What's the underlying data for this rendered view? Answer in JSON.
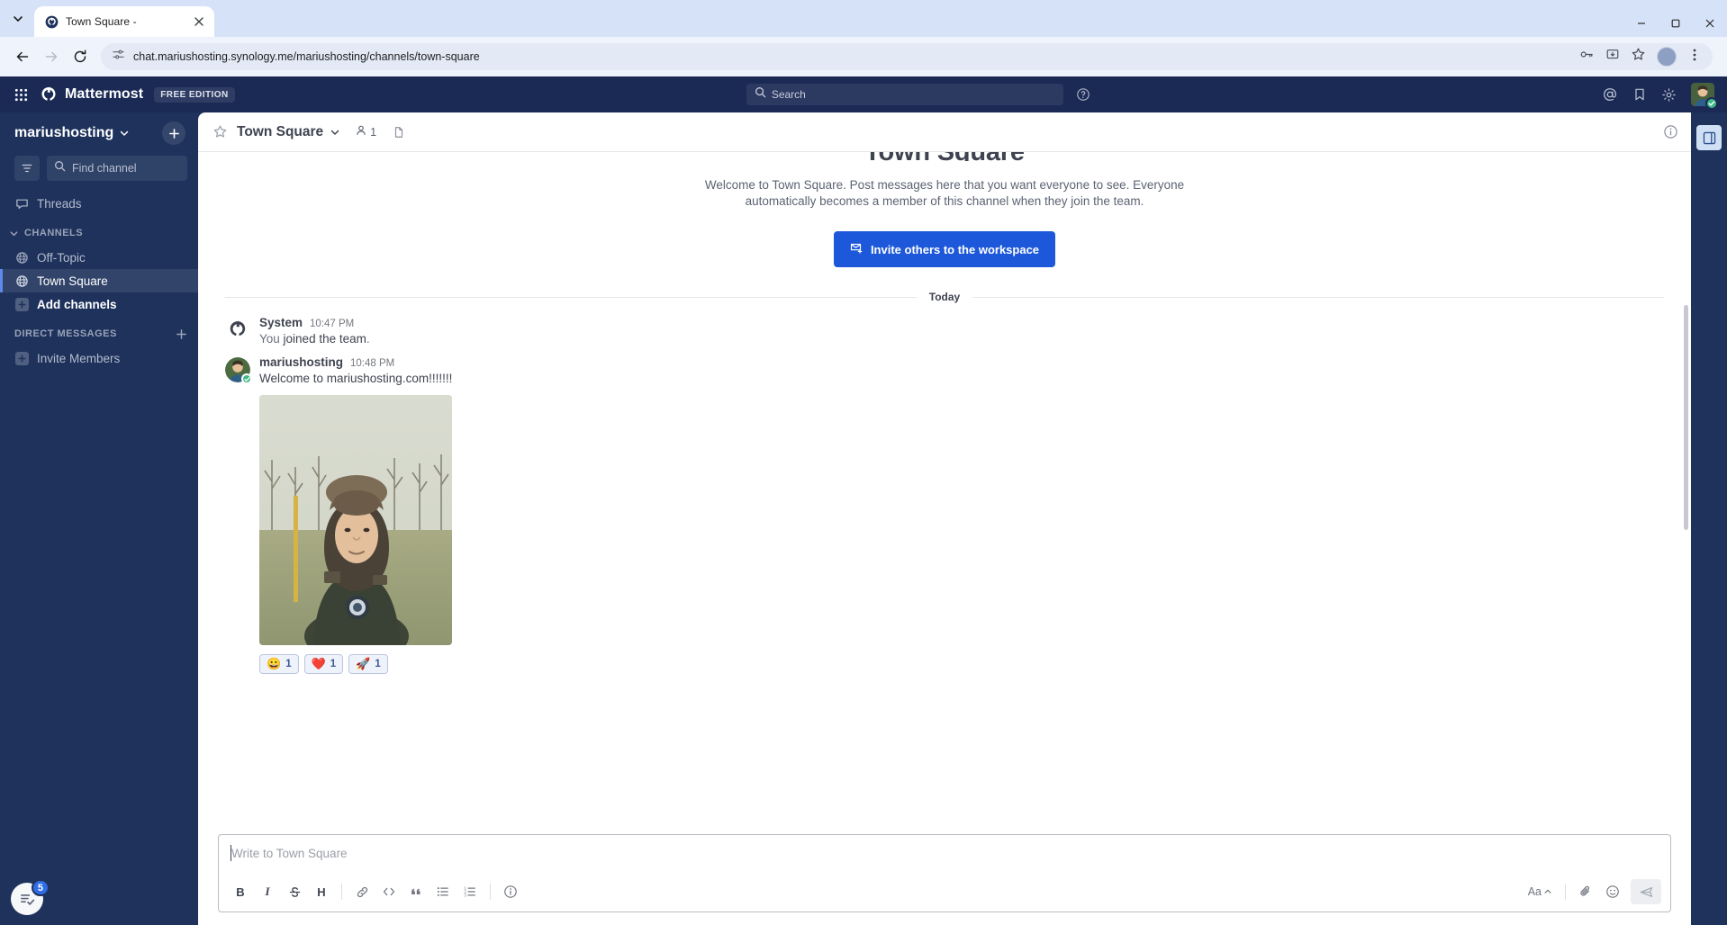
{
  "browser": {
    "tab": {
      "title": "Town Square -",
      "favicon_icon": "mattermost-favicon"
    },
    "url": "chat.mariushosting.synology.me/mariushosting/channels/town-square",
    "nav": {
      "back": "back-icon",
      "forward": "forward-icon",
      "reload": "reload-icon"
    },
    "omnibox_icons": [
      "site-settings-icon",
      "password-key-icon",
      "install-app-icon",
      "bookmark-star-icon"
    ],
    "window_controls": {
      "minimize": "–",
      "maximize": "☐",
      "close": "✕"
    }
  },
  "global_header": {
    "product_switcher_icon": "grid-apps-icon",
    "brand": "Mattermost",
    "edition_badge": "FREE EDITION",
    "search": {
      "placeholder": "Search",
      "icon": "search-icon"
    },
    "help_icon": "help-circle-icon",
    "icons": [
      "at-mention-icon",
      "saved-posts-icon",
      "settings-gear-icon"
    ],
    "avatar": {
      "name": "avatar",
      "status": "online"
    }
  },
  "sidebar": {
    "team_name": "mariushosting",
    "team_chevron_icon": "chevron-down-icon",
    "add_button_icon": "plus-icon",
    "filter_icon": "filter-icon",
    "find_channel_placeholder": "Find channel",
    "threads": {
      "label": "Threads",
      "icon": "threads-icon"
    },
    "categories": [
      {
        "label": "CHANNELS",
        "chevron_icon": "chevron-down-icon",
        "items": [
          {
            "label": "Off-Topic",
            "icon": "globe-icon",
            "active": false
          },
          {
            "label": "Town Square",
            "icon": "globe-icon",
            "active": true
          },
          {
            "label": "Add channels",
            "icon": "plus-square-icon",
            "active": false,
            "bold": true
          }
        ]
      },
      {
        "label": "DIRECT MESSAGES",
        "add_icon": "plus-icon",
        "items": [
          {
            "label": "Invite Members",
            "icon": "plus-square-icon",
            "active": false
          }
        ]
      }
    ],
    "tasks_badge_count": "5",
    "tasks_icon": "checklist-icon"
  },
  "channel_header": {
    "star_icon": "star-outline-icon",
    "title": "Town Square",
    "chevron_icon": "chevron-down-icon",
    "member_count": "1",
    "member_icon": "person-icon",
    "file_icon": "file-icon",
    "info_icon": "info-circle-icon"
  },
  "intro": {
    "title": "Town Square",
    "description": "Welcome to Town Square. Post messages here that you want everyone to see. Everyone automatically becomes a member of this channel when they join the team.",
    "invite_button": {
      "label": "Invite others to the workspace",
      "icon": "envelope-plus-icon",
      "color": "#1c58d9"
    }
  },
  "day_divider": "Today",
  "posts": [
    {
      "author": "System",
      "time": "10:47 PM",
      "avatar": "mattermost-system-avatar",
      "text_prefix": "You ",
      "text_main": "joined the team",
      "text_suffix": ".",
      "has_image": false,
      "reactions": []
    },
    {
      "author": "mariushosting",
      "time": "10:48 PM",
      "avatar": "user-photo-avatar",
      "status": "online",
      "text": "Welcome to mariushosting.com!!!!!!!",
      "has_image": true,
      "image_alt": "photo of person in winter jacket with fur hat outdoors",
      "reactions": [
        {
          "emoji": "😀",
          "name": "grinning-face",
          "count": "1"
        },
        {
          "emoji": "❤️",
          "name": "heart",
          "count": "1"
        },
        {
          "emoji": "🚀",
          "name": "rocket",
          "count": "1"
        }
      ]
    }
  ],
  "composer": {
    "placeholder": "Write to Town Square",
    "toolbar": [
      {
        "name": "bold-button",
        "label": "B"
      },
      {
        "name": "italic-button",
        "label": "I"
      },
      {
        "name": "strikethrough-button",
        "label": "S"
      },
      {
        "name": "heading-button",
        "label": "H"
      },
      {
        "name": "link-button",
        "label": "link-icon"
      },
      {
        "name": "code-button",
        "label": "code-icon"
      },
      {
        "name": "quote-button",
        "label": "quote-icon"
      },
      {
        "name": "bulleted-list-button",
        "label": "bullet-list-icon"
      },
      {
        "name": "numbered-list-button",
        "label": "ordered-list-icon"
      },
      {
        "name": "formatting-help-button",
        "label": "info-icon"
      }
    ],
    "preview_label": "Aa",
    "attach_icon": "paperclip-icon",
    "emoji_icon": "emoji-smile-icon",
    "send_icon": "send-icon"
  },
  "right_rail": {
    "icon": "apps-bar-icon"
  }
}
